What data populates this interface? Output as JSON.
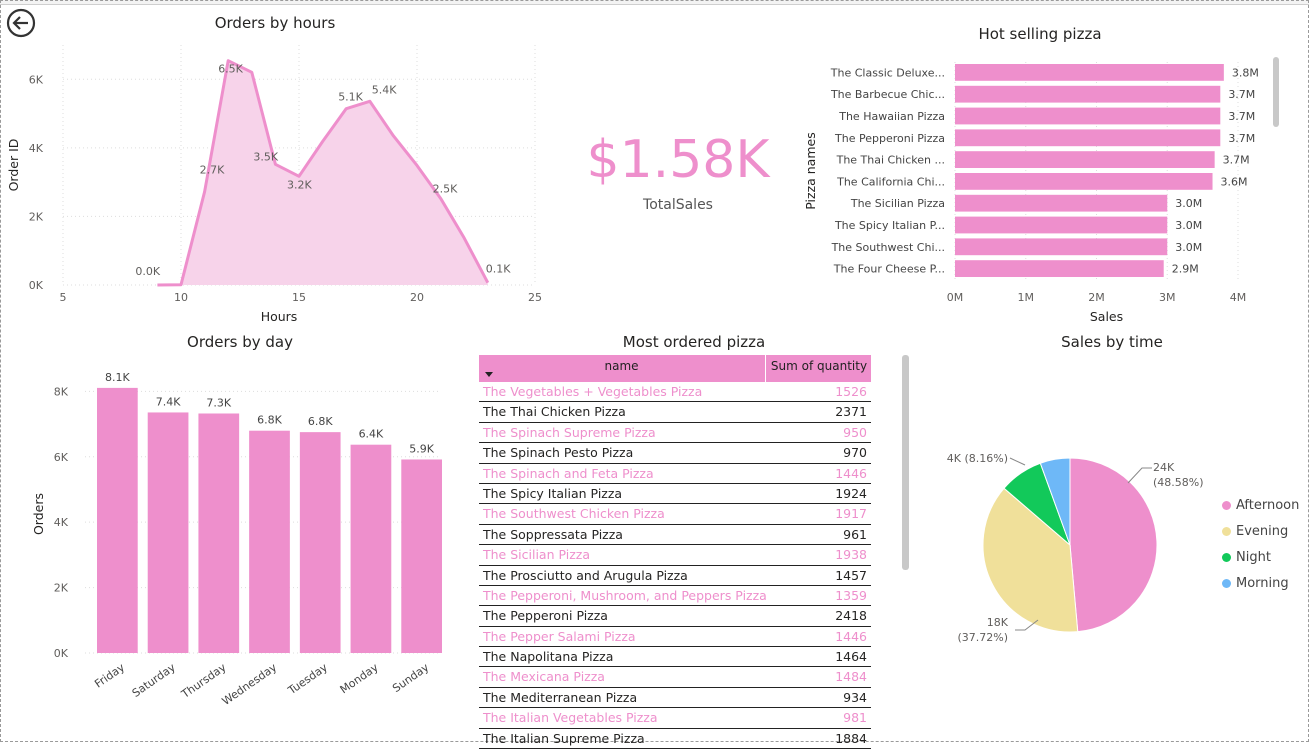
{
  "colors": {
    "accent": "#EE8FCC",
    "evening": "#F0E09A",
    "night": "#12C95A",
    "morning": "#6EB8F7",
    "kpi": "#EE8FCC"
  },
  "kpi": {
    "value": "$1.58K",
    "label": "TotalSales"
  },
  "table": {
    "title": "Most ordered pizza",
    "col_name": "name",
    "col_qty": "Sum of quantity",
    "rows": [
      {
        "name": "The Vegetables + Vegetables Pizza",
        "qty": "1526"
      },
      {
        "name": "The Thai Chicken Pizza",
        "qty": "2371"
      },
      {
        "name": "The Spinach Supreme Pizza",
        "qty": "950"
      },
      {
        "name": "The Spinach Pesto Pizza",
        "qty": "970"
      },
      {
        "name": "The Spinach and Feta Pizza",
        "qty": "1446"
      },
      {
        "name": "The Spicy Italian Pizza",
        "qty": "1924"
      },
      {
        "name": "The Southwest Chicken Pizza",
        "qty": "1917"
      },
      {
        "name": "The Soppressata Pizza",
        "qty": "961"
      },
      {
        "name": "The Sicilian Pizza",
        "qty": "1938"
      },
      {
        "name": "The Prosciutto and Arugula Pizza",
        "qty": "1457"
      },
      {
        "name": "The Pepperoni, Mushroom, and Peppers Pizza",
        "qty": "1359"
      },
      {
        "name": "The Pepperoni Pizza",
        "qty": "2418"
      },
      {
        "name": "The Pepper Salami Pizza",
        "qty": "1446"
      },
      {
        "name": "The Napolitana Pizza",
        "qty": "1464"
      },
      {
        "name": "The Mexicana Pizza",
        "qty": "1484"
      },
      {
        "name": "The Mediterranean Pizza",
        "qty": "934"
      },
      {
        "name": "The Italian Vegetables Pizza",
        "qty": "981"
      },
      {
        "name": "The Italian Supreme Pizza",
        "qty": "1884"
      }
    ]
  },
  "chart_data": [
    {
      "type": "area",
      "title": "Orders by hours",
      "xlabel": "Hours",
      "ylabel": "Order ID",
      "xlim": [
        5,
        25
      ],
      "ylim": [
        0,
        7000
      ],
      "xticks": [
        "5",
        "10",
        "15",
        "20",
        "25"
      ],
      "yticks": [
        "0K",
        "2K",
        "4K",
        "6K"
      ],
      "x": [
        9,
        10,
        11,
        12,
        13,
        14,
        15,
        16,
        17,
        18,
        19,
        20,
        21,
        22,
        23
      ],
      "values": [
        1,
        8,
        2720,
        6543,
        6203,
        3521,
        3170,
        4185,
        5143,
        5359,
        4350,
        3487,
        2528,
        1370,
        68
      ],
      "labels": {
        "9": "0.0K",
        "11": "2.7K",
        "12": "6.5K",
        "14": "3.5K",
        "15": "3.2K",
        "17": "5.1K",
        "18": "5.4K",
        "21": "2.5K",
        "23": "0.1K"
      }
    },
    {
      "type": "bar",
      "orientation": "horizontal",
      "title": "Hot selling pizza",
      "xlabel": "Sales",
      "ylabel": "Pizza names",
      "xlim": [
        0,
        4000000
      ],
      "xticks": [
        "0M",
        "1M",
        "2M",
        "3M",
        "4M"
      ],
      "categories": [
        "The Classic Deluxe...",
        "The Barbecue Chic...",
        "The Hawaiian Pizza",
        "The Pepperoni Pizza",
        "The Thai Chicken ...",
        "The California Chi...",
        "The Sicilian Pizza",
        "The Spicy Italian P...",
        "The Southwest Chi...",
        "The Four Cheese P..."
      ],
      "values": [
        3800000,
        3750000,
        3750000,
        3750000,
        3670000,
        3640000,
        3000000,
        3000000,
        3000000,
        2950000
      ],
      "data_labels": [
        "3.8M",
        "3.7M",
        "3.7M",
        "3.7M",
        "3.7M",
        "3.6M",
        "3.0M",
        "3.0M",
        "3.0M",
        "2.9M"
      ]
    },
    {
      "type": "bar",
      "title": "Orders by day",
      "xlabel": "",
      "ylabel": "Orders",
      "ylim": [
        0,
        8500
      ],
      "yticks": [
        "0K",
        "2K",
        "4K",
        "6K",
        "8K"
      ],
      "categories": [
        "Friday",
        "Saturday",
        "Thursday",
        "Wednesday",
        "Tuesday",
        "Monday",
        "Sunday"
      ],
      "values": [
        8106,
        7355,
        7323,
        6797,
        6753,
        6369,
        5917
      ],
      "data_labels": [
        "8.1K",
        "7.4K",
        "7.3K",
        "6.8K",
        "6.8K",
        "6.4K",
        "5.9K"
      ]
    },
    {
      "type": "pie",
      "title": "Sales by time",
      "categories": [
        "Afternoon",
        "Evening",
        "Night",
        "Morning"
      ],
      "values": [
        48.58,
        37.72,
        8.16,
        5.54
      ],
      "data_labels": [
        "24K\n(48.58%)",
        "18K\n(37.72%)",
        "4K (8.16%)",
        ""
      ],
      "legend": "right"
    }
  ]
}
